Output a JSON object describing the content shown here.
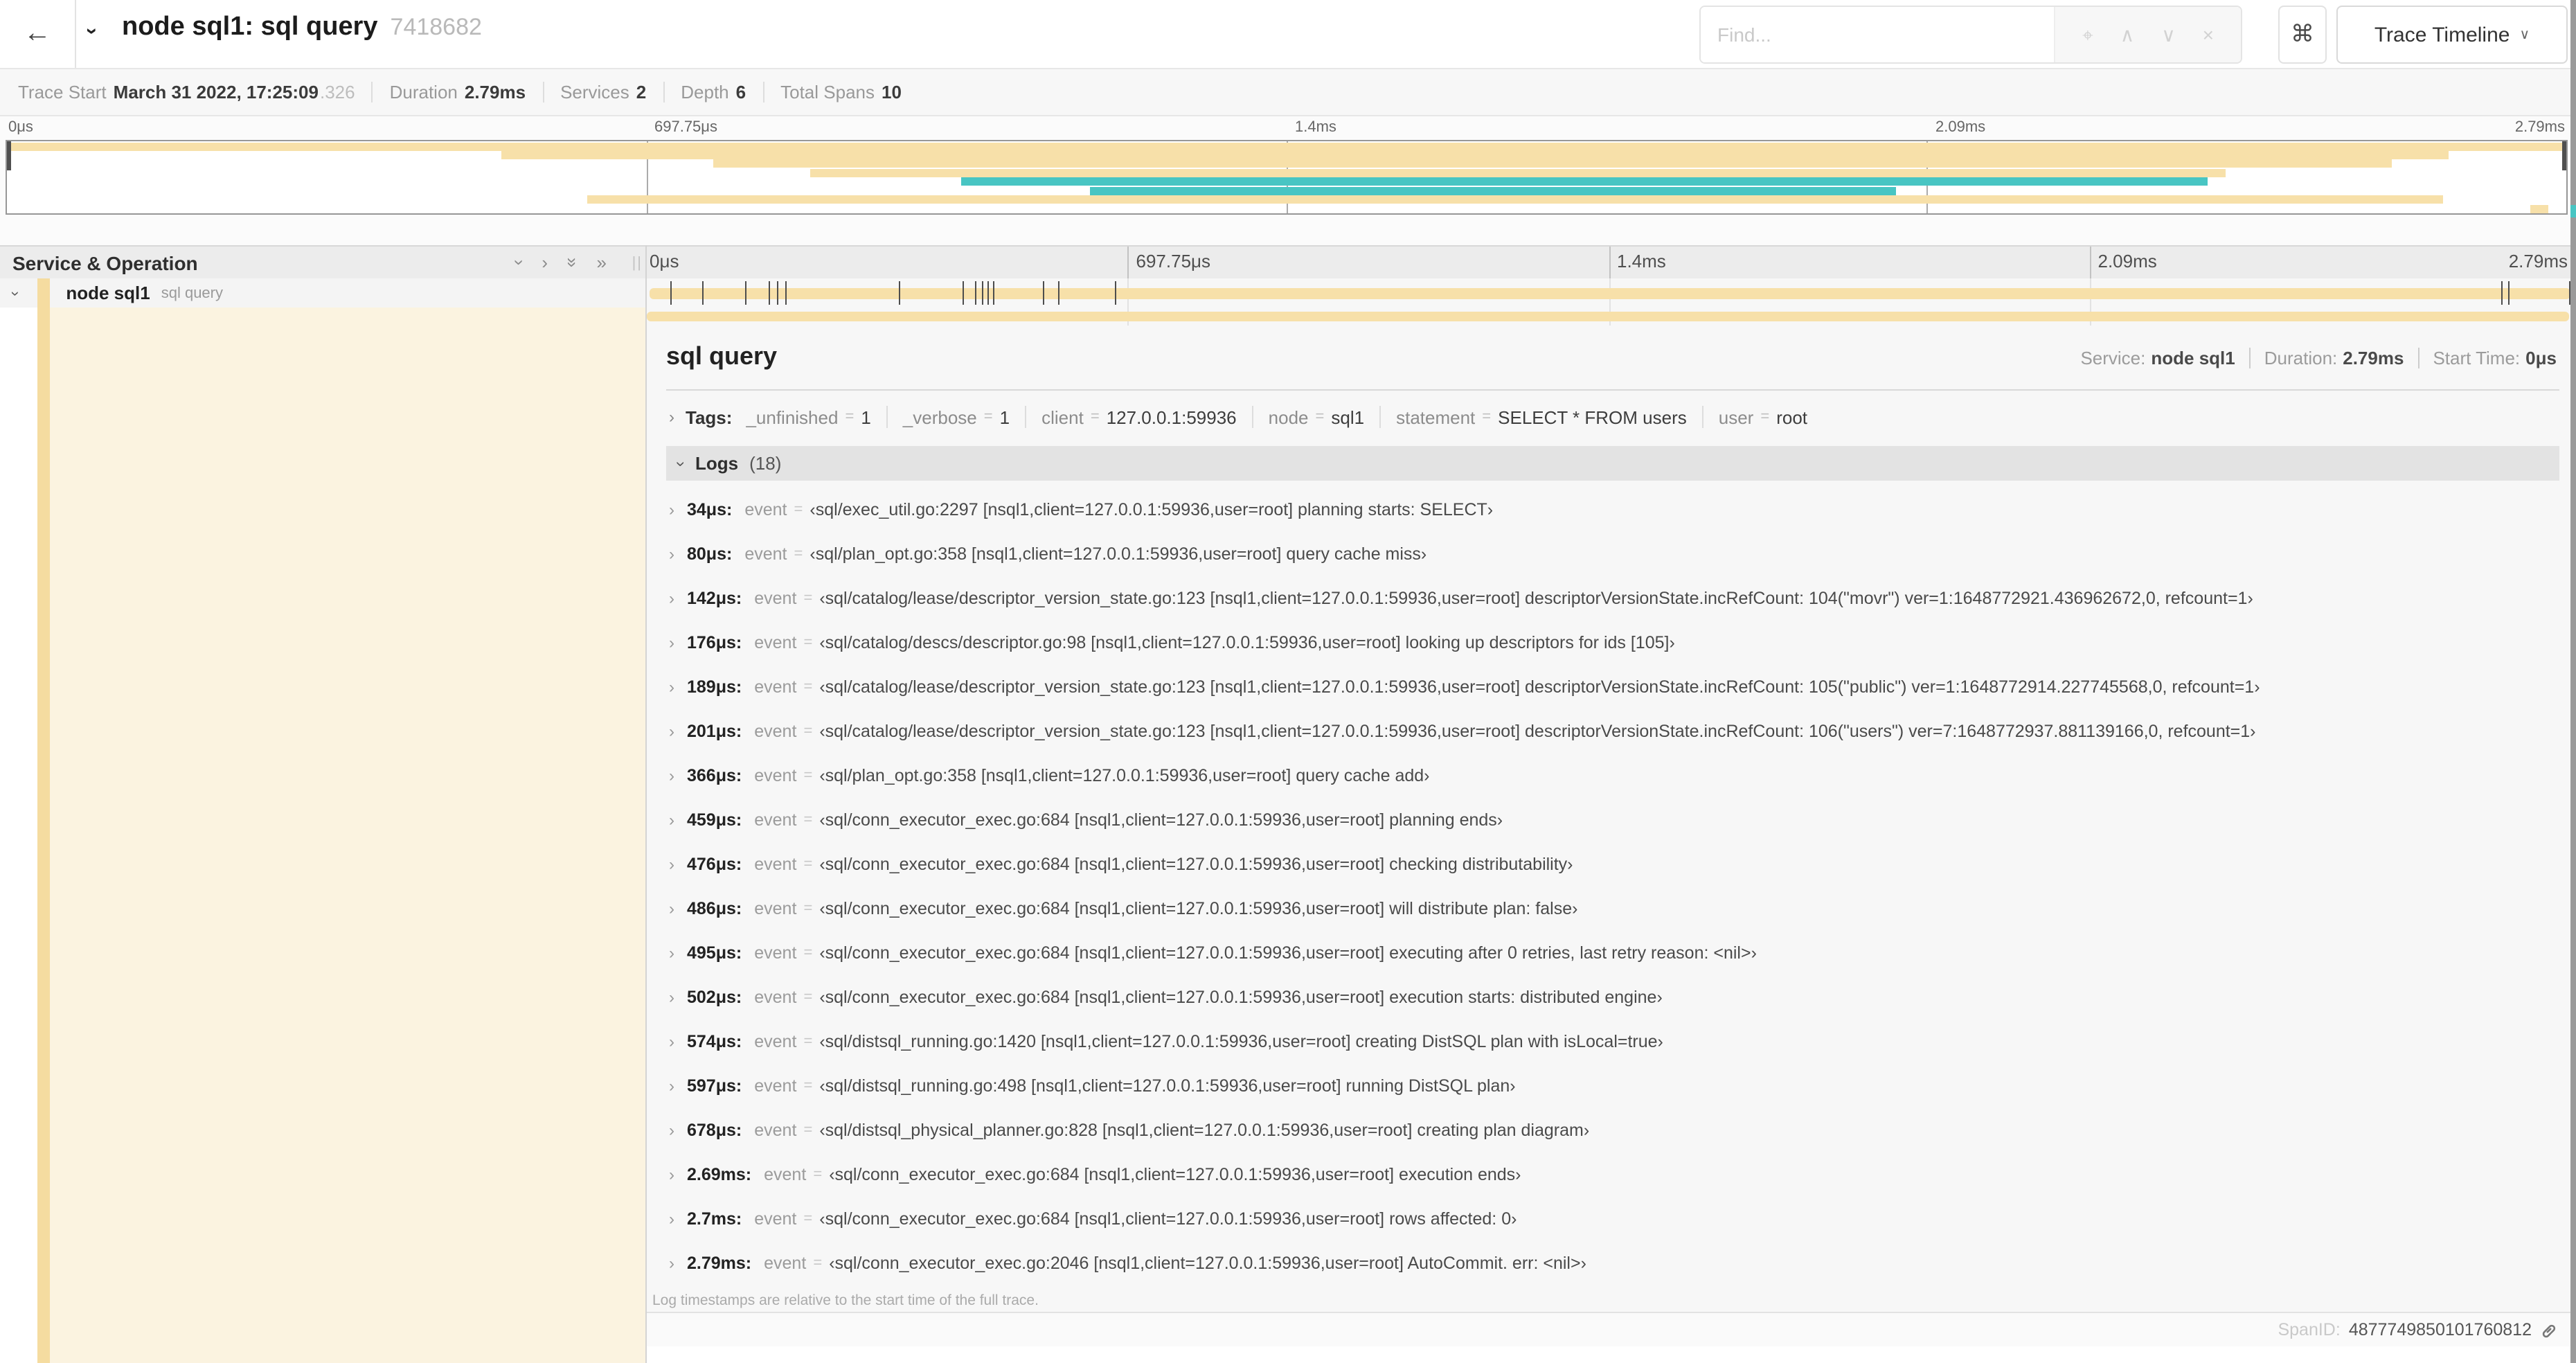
{
  "colors": {
    "span": "#F7E0A9",
    "flow": "#48C5C3",
    "accent_stripe": "#F5DCA0",
    "cream": "#FBF3E0",
    "marker": "#4d4d4d"
  },
  "icons": {
    "back": "←",
    "chevron_right": "›",
    "double_chevron_right": "»",
    "find_target": "⌖",
    "chevron_up_small": "∧",
    "chevron_down_small": "∨",
    "close": "×",
    "command": "⌘",
    "resize_grip": "||",
    "caret_down": "∨"
  },
  "misc": {
    "eq": "="
  },
  "header": {
    "title": "node sql1: sql query",
    "trace_id": "7418682",
    "find_placeholder": "Find...",
    "view_selector_label": "Trace Timeline"
  },
  "trace_info": {
    "items": [
      {
        "label": "Trace Start",
        "value": "March 31 2022, 17:25:09",
        "suffix": ".326"
      },
      {
        "label": "Duration",
        "value": "2.79ms",
        "suffix": ""
      },
      {
        "label": "Services",
        "value": "2",
        "suffix": ""
      },
      {
        "label": "Depth",
        "value": "6",
        "suffix": ""
      },
      {
        "label": "Total Spans",
        "value": "10",
        "suffix": ""
      }
    ]
  },
  "minimap": {
    "bars": [
      {
        "color": "span",
        "start": 0.15,
        "end": 99.85
      },
      {
        "color": "span",
        "start": 19.3,
        "end": 95.4
      },
      {
        "color": "span",
        "start": 27.6,
        "end": 93.2
      },
      {
        "color": "span",
        "start": 31.4,
        "end": 86.7
      },
      {
        "color": "flow",
        "start": 37.3,
        "end": 86.0
      },
      {
        "color": "flow",
        "start": 42.3,
        "end": 73.8
      },
      {
        "color": "span",
        "start": 22.7,
        "end": 95.2
      },
      {
        "color": "span",
        "start": 98.6,
        "end": 99.3
      }
    ]
  },
  "timeline": {
    "header_label": "Service & Operation",
    "ruler_ticks": [
      "0μs",
      "697.75μs",
      "1.4ms",
      "2.09ms",
      "2.79ms"
    ],
    "tick_positions": [
      0,
      25,
      50,
      75,
      100
    ],
    "row": {
      "service": "node sql1",
      "operation": "sql query"
    },
    "log_marker_pcts": [
      1.22,
      2.87,
      5.09,
      6.31,
      6.77,
      7.2,
      13.12,
      16.45,
      17.06,
      17.42,
      17.74,
      18.0,
      20.57,
      21.4,
      24.3,
      96.42,
      96.77,
      100
    ]
  },
  "detail": {
    "title": "sql query",
    "service_label": "Service:",
    "service": "node sql1",
    "duration_label": "Duration:",
    "duration": "2.79ms",
    "start_label": "Start Time:",
    "start": "0μs",
    "tags_label": "Tags:",
    "tags": [
      {
        "key": "_unfinished",
        "value": "1"
      },
      {
        "key": "_verbose",
        "value": "1"
      },
      {
        "key": "client",
        "value": "127.0.0.1:59936"
      },
      {
        "key": "node",
        "value": "sql1"
      },
      {
        "key": "statement",
        "value": "SELECT * FROM users"
      },
      {
        "key": "user",
        "value": "root"
      }
    ],
    "logs_label": "Logs",
    "logs_count": "(18)",
    "logs_event_key": "event",
    "logs": [
      {
        "time": "34μs:",
        "value": "‹sql/exec_util.go:2297 [nsql1,client=127.0.0.1:59936,user=root] planning starts: SELECT›"
      },
      {
        "time": "80μs:",
        "value": "‹sql/plan_opt.go:358 [nsql1,client=127.0.0.1:59936,user=root] query cache miss›"
      },
      {
        "time": "142μs:",
        "value": "‹sql/catalog/lease/descriptor_version_state.go:123 [nsql1,client=127.0.0.1:59936,user=root] descriptorVersionState.incRefCount: 104(\"movr\") ver=1:1648772921.436962672,0, refcount=1›"
      },
      {
        "time": "176μs:",
        "value": "‹sql/catalog/descs/descriptor.go:98 [nsql1,client=127.0.0.1:59936,user=root] looking up descriptors for ids [105]›"
      },
      {
        "time": "189μs:",
        "value": "‹sql/catalog/lease/descriptor_version_state.go:123 [nsql1,client=127.0.0.1:59936,user=root] descriptorVersionState.incRefCount: 105(\"public\") ver=1:1648772914.227745568,0, refcount=1›"
      },
      {
        "time": "201μs:",
        "value": "‹sql/catalog/lease/descriptor_version_state.go:123 [nsql1,client=127.0.0.1:59936,user=root] descriptorVersionState.incRefCount: 106(\"users\") ver=7:1648772937.881139166,0, refcount=1›"
      },
      {
        "time": "366μs:",
        "value": "‹sql/plan_opt.go:358 [nsql1,client=127.0.0.1:59936,user=root] query cache add›"
      },
      {
        "time": "459μs:",
        "value": "‹sql/conn_executor_exec.go:684 [nsql1,client=127.0.0.1:59936,user=root] planning ends›"
      },
      {
        "time": "476μs:",
        "value": "‹sql/conn_executor_exec.go:684 [nsql1,client=127.0.0.1:59936,user=root] checking distributability›"
      },
      {
        "time": "486μs:",
        "value": "‹sql/conn_executor_exec.go:684 [nsql1,client=127.0.0.1:59936,user=root] will distribute plan: false›"
      },
      {
        "time": "495μs:",
        "value": "‹sql/conn_executor_exec.go:684 [nsql1,client=127.0.0.1:59936,user=root] executing after 0 retries, last retry reason: <nil>›"
      },
      {
        "time": "502μs:",
        "value": "‹sql/conn_executor_exec.go:684 [nsql1,client=127.0.0.1:59936,user=root] execution starts: distributed engine›"
      },
      {
        "time": "574μs:",
        "value": "‹sql/distsql_running.go:1420 [nsql1,client=127.0.0.1:59936,user=root] creating DistSQL plan with isLocal=true›"
      },
      {
        "time": "597μs:",
        "value": "‹sql/distsql_running.go:498 [nsql1,client=127.0.0.1:59936,user=root] running DistSQL plan›"
      },
      {
        "time": "678μs:",
        "value": "‹sql/distsql_physical_planner.go:828 [nsql1,client=127.0.0.1:59936,user=root] creating plan diagram›"
      },
      {
        "time": "2.69ms:",
        "value": "‹sql/conn_executor_exec.go:684 [nsql1,client=127.0.0.1:59936,user=root] execution ends›"
      },
      {
        "time": "2.7ms:",
        "value": "‹sql/conn_executor_exec.go:684 [nsql1,client=127.0.0.1:59936,user=root] rows affected: 0›"
      },
      {
        "time": "2.79ms:",
        "value": "‹sql/conn_executor_exec.go:2046 [nsql1,client=127.0.0.1:59936,user=root] AutoCommit. err: <nil>›"
      }
    ],
    "footer_note": "Log timestamps are relative to the start time of the full trace.",
    "span_id_label": "SpanID:",
    "span_id": "4877749850101760812"
  }
}
